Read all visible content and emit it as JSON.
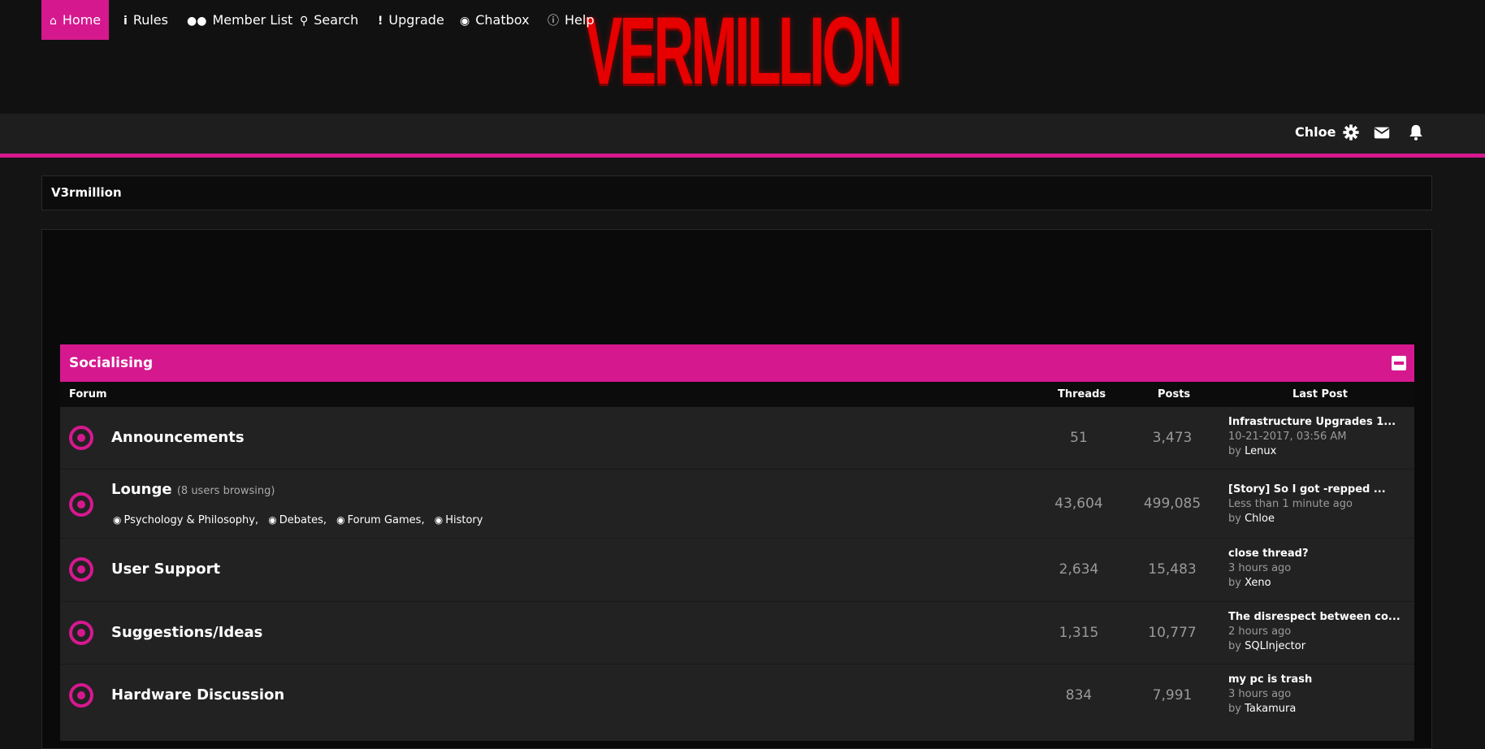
{
  "site": {
    "logo_text": "VERMILLION"
  },
  "nav": {
    "items": [
      {
        "label": "Home",
        "icon": "home-icon"
      },
      {
        "label": "Rules",
        "icon": "info-icon"
      },
      {
        "label": "Member List",
        "icon": "users-icon"
      },
      {
        "label": "Search",
        "icon": "search-icon"
      },
      {
        "label": "Upgrade",
        "icon": "exclamation-icon"
      },
      {
        "label": "Chatbox",
        "icon": "comment-icon"
      },
      {
        "label": "Help",
        "icon": "info-circle-icon"
      }
    ],
    "active": "Home",
    "user": "Chloe",
    "user_icons": [
      "gear-icon",
      "envelope-icon",
      "bell-icon"
    ]
  },
  "breadcrumb": {
    "label": "V3rmillion"
  },
  "category": {
    "title": "Socialising",
    "columns": {
      "forum": "Forum",
      "threads": "Threads",
      "posts": "Posts",
      "last_post": "Last Post"
    },
    "forums": [
      {
        "name": "Announcements",
        "threads": "51",
        "posts": "3,473",
        "last_post": {
          "title": "Infrastructure Upgrades 1...",
          "date": "10-21-2017, 03:56 AM",
          "by": "by",
          "author": "Lenux"
        }
      },
      {
        "name": "Lounge",
        "browsing": "(8 users browsing)",
        "threads": "43,604",
        "posts": "499,085",
        "subforums": [
          "Psychology & Philosophy",
          "Debates",
          "Forum Games",
          "History"
        ],
        "last_post": {
          "title": "[Story] So I got -repped ...",
          "date": "Less than 1 minute ago",
          "by": "by",
          "author": "Chloe"
        }
      },
      {
        "name": "User Support",
        "threads": "2,634",
        "posts": "15,483",
        "last_post": {
          "title": "close thread?",
          "date": "3 hours ago",
          "by": "by",
          "author": "Xeno"
        }
      },
      {
        "name": "Suggestions/Ideas",
        "threads": "1,315",
        "posts": "10,777",
        "last_post": {
          "title": "The disrespect between co...",
          "date": "2 hours ago",
          "by": "by",
          "author": "SQLInjector"
        }
      },
      {
        "name": "Hardware Discussion",
        "threads": "834",
        "posts": "7,991",
        "last_post": {
          "title": "my pc is trash",
          "date": "3 hours ago",
          "by": "by",
          "author": "Takamura"
        }
      }
    ]
  },
  "colors": {
    "accent": "#d6188f",
    "logo": "#e60000",
    "background": "#141414"
  }
}
